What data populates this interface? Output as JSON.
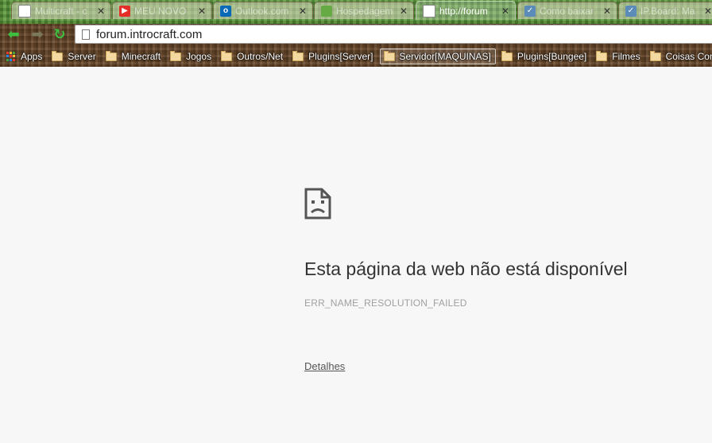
{
  "tabs": [
    {
      "title": "Multicraft - c",
      "favicon": "page-icon",
      "active": false
    },
    {
      "title": "MEU NOVO",
      "favicon": "youtube-icon",
      "active": false
    },
    {
      "title": "Outlook.com",
      "favicon": "outlook-icon",
      "active": false
    },
    {
      "title": "Hospedagem",
      "favicon": "hosting-icon",
      "active": false
    },
    {
      "title": "http://forum",
      "favicon": "page-icon",
      "active": true
    },
    {
      "title": "Como baixar",
      "favicon": "forum-icon",
      "active": false
    },
    {
      "title": "IP.Board: Ma",
      "favicon": "forum-icon",
      "active": false
    }
  ],
  "toolbar": {
    "url": "forum.introcraft.com",
    "accent_color": "#3fbf3f"
  },
  "bookmarks": {
    "apps_label": "Apps",
    "items": [
      {
        "label": "Server"
      },
      {
        "label": "Minecraft"
      },
      {
        "label": "Jogos"
      },
      {
        "label": "Outros/Net"
      },
      {
        "label": "Plugins[Server]"
      },
      {
        "label": "Servidor[MAQUINAS]"
      },
      {
        "label": "Plugins[Bungee]"
      },
      {
        "label": "Filmes"
      },
      {
        "label": "Coisas Com"
      }
    ]
  },
  "error": {
    "title": "Esta página da web não está disponível",
    "code": "ERR_NAME_RESOLUTION_FAILED",
    "details_label": "Detalhes"
  }
}
